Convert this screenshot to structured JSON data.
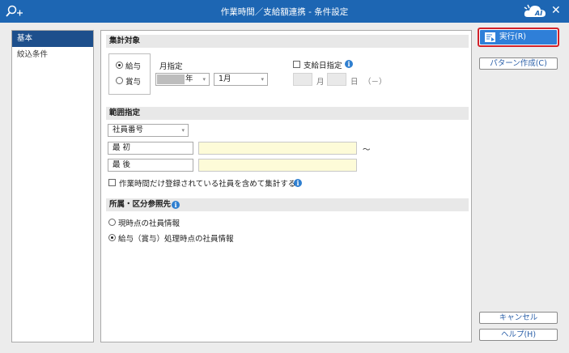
{
  "window": {
    "title": "作業時間／支給額連携 - 条件設定",
    "ai_badge": "AI"
  },
  "sidebar": {
    "items": [
      {
        "label": "基本"
      },
      {
        "label": "絞込条件"
      }
    ]
  },
  "aggregation": {
    "header": "集計対象",
    "options": [
      {
        "label": "給与",
        "selected": true
      },
      {
        "label": "賞与",
        "selected": false
      }
    ],
    "month_label": "月指定",
    "year_suffix": "年",
    "month_value": "1月",
    "payday_label": "支給日指定",
    "payday_checked": false,
    "month_unit": "月",
    "day_unit": "日",
    "weekday": "（－）"
  },
  "range": {
    "header": "範囲指定",
    "key_select": "社員番号",
    "first_label": "最 初",
    "last_label": "最 後",
    "tilde": "～",
    "include_label": "作業時間だけ登録されている社員を含めて集計する",
    "include_checked": false
  },
  "affiliation": {
    "header": "所属・区分参照先",
    "options": [
      {
        "label": "現時点の社員情報",
        "selected": false
      },
      {
        "label": "給与（賞与）処理時点の社員情報",
        "selected": true
      }
    ]
  },
  "buttons": {
    "run": "実行(R)",
    "pattern": "パターン作成(C)",
    "cancel": "キャンセル",
    "help": "ヘルプ(H)"
  },
  "colors": {
    "titlebar": "#1d66b3",
    "sidebar_active": "#1d4f8c",
    "run_button": "#2f7fd8",
    "run_highlight": "#d2222a",
    "input_highlight": "#fdfbd8"
  }
}
